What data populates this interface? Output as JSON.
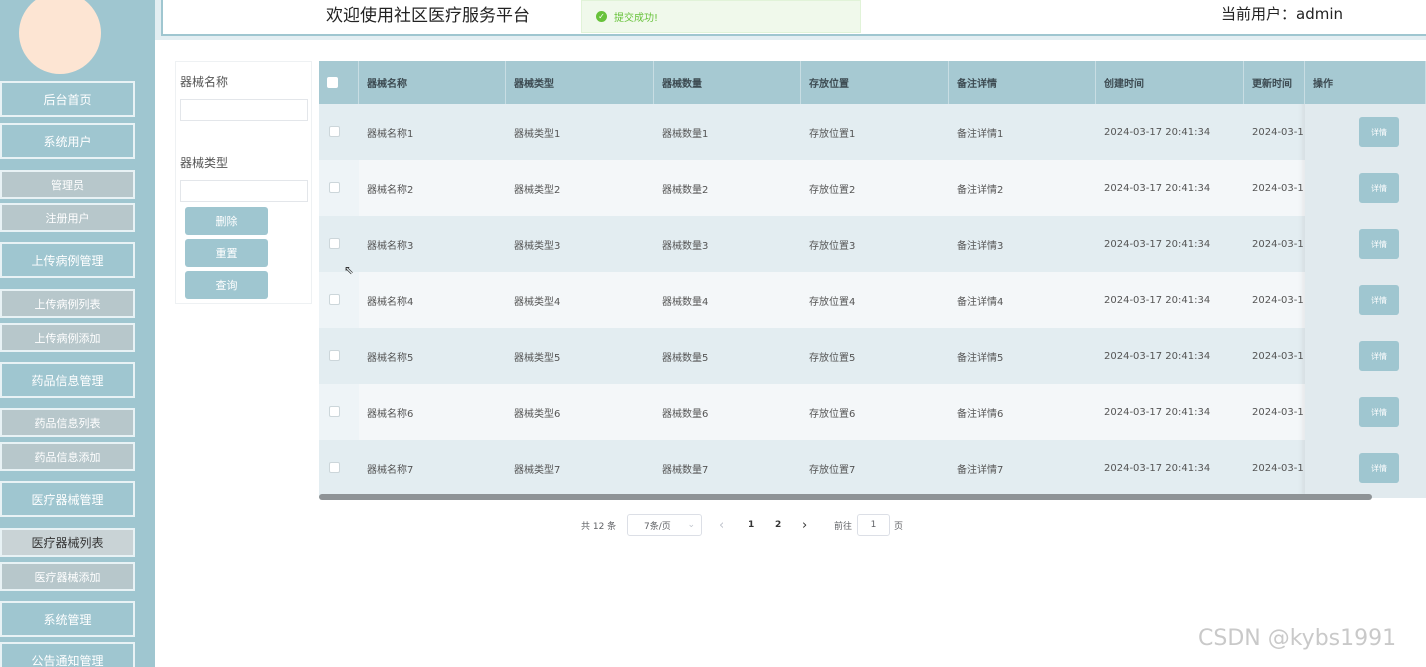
{
  "header": {
    "welcome": "欢迎使用社区医疗服务平台",
    "current_user": "当前用户：admin"
  },
  "toast": {
    "message": "提交成功!",
    "icon": "check-circle-icon",
    "color": "#67c23a"
  },
  "sidebar": {
    "items": [
      {
        "label": "后台首页",
        "type": "main"
      },
      {
        "label": "系统用户",
        "type": "main"
      },
      {
        "label": "管理员",
        "type": "sub"
      },
      {
        "label": "注册用户",
        "type": "sub"
      },
      {
        "label": "上传病例管理",
        "type": "main"
      },
      {
        "label": "上传病例列表",
        "type": "sub"
      },
      {
        "label": "上传病例添加",
        "type": "sub"
      },
      {
        "label": "药品信息管理",
        "type": "main"
      },
      {
        "label": "药品信息列表",
        "type": "sub"
      },
      {
        "label": "药品信息添加",
        "type": "sub"
      },
      {
        "label": "医疗器械管理",
        "type": "main"
      },
      {
        "label": "医疗器械列表",
        "type": "sub",
        "active": true
      },
      {
        "label": "医疗器械添加",
        "type": "sub"
      },
      {
        "label": "系统管理",
        "type": "main"
      },
      {
        "label": "公告通知管理",
        "type": "main"
      }
    ]
  },
  "search": {
    "name_label": "器械名称",
    "type_label": "器械类型",
    "delete_label": "删除",
    "reset_label": "重置",
    "query_label": "查询"
  },
  "table": {
    "headers": [
      "器械名称",
      "器械类型",
      "器械数量",
      "存放位置",
      "备注详情",
      "创建时间",
      "更新时间",
      "操作"
    ],
    "rows": [
      [
        "器械名称1",
        "器械类型1",
        "器械数量1",
        "存放位置1",
        "备注详情1",
        "2024-03-17 20:41:34",
        "2024-03-1"
      ],
      [
        "器械名称2",
        "器械类型2",
        "器械数量2",
        "存放位置2",
        "备注详情2",
        "2024-03-17 20:41:34",
        "2024-03-1"
      ],
      [
        "器械名称3",
        "器械类型3",
        "器械数量3",
        "存放位置3",
        "备注详情3",
        "2024-03-17 20:41:34",
        "2024-03-1"
      ],
      [
        "器械名称4",
        "器械类型4",
        "器械数量4",
        "存放位置4",
        "备注详情4",
        "2024-03-17 20:41:34",
        "2024-03-1"
      ],
      [
        "器械名称5",
        "器械类型5",
        "器械数量5",
        "存放位置5",
        "备注详情5",
        "2024-03-17 20:41:34",
        "2024-03-1"
      ],
      [
        "器械名称6",
        "器械类型6",
        "器械数量6",
        "存放位置6",
        "备注详情6",
        "2024-03-17 20:41:34",
        "2024-03-1"
      ],
      [
        "器械名称7",
        "器械类型7",
        "器械数量7",
        "存放位置7",
        "备注详情7",
        "2024-03-17 20:41:34",
        "2024-03-1"
      ]
    ],
    "detail_label": "详情"
  },
  "pagination": {
    "total": "共 12 条",
    "page_size": "7条/页",
    "prev": "‹",
    "pages": [
      "1",
      "2"
    ],
    "next": "›",
    "goto_label": "前往",
    "goto_value": "1",
    "page_suffix": "页"
  },
  "watermark": "CSDN @kybs1991",
  "colors": {
    "accent": "#9fc6d0",
    "success": "#67c23a"
  }
}
